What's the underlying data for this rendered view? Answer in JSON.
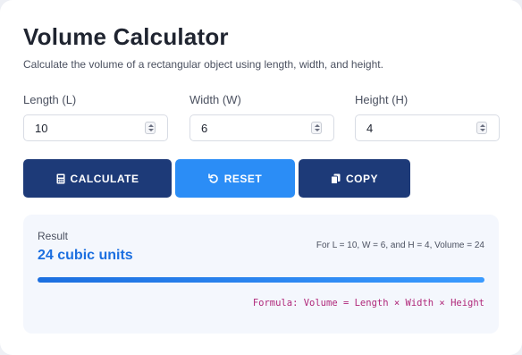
{
  "header": {
    "title": "Volume Calculator",
    "subtitle": "Calculate the volume of a rectangular object using length, width, and height."
  },
  "fields": [
    {
      "label": "Length (L)",
      "value": "10"
    },
    {
      "label": "Width (W)",
      "value": "6"
    },
    {
      "label": "Height (H)",
      "value": "4"
    }
  ],
  "buttons": {
    "calculate": "CALCULATE",
    "reset": "RESET",
    "copy": "COPY"
  },
  "result": {
    "label": "Result",
    "value": "24 cubic units",
    "detail": "For L = 10, W = 6, and H = 4, Volume = 24",
    "progress": 1.0,
    "formula": "Formula: Volume = Length × Width × Height"
  },
  "colors": {
    "primary_dark": "#1d3a78",
    "primary_blue": "#2b8df6",
    "result_value": "#1c6fe0",
    "formula": "#b0287a"
  },
  "icons": {
    "calculate": "calculator-icon",
    "reset": "reset-icon",
    "copy": "copy-icon",
    "spinner": "number-spinner-icon"
  }
}
